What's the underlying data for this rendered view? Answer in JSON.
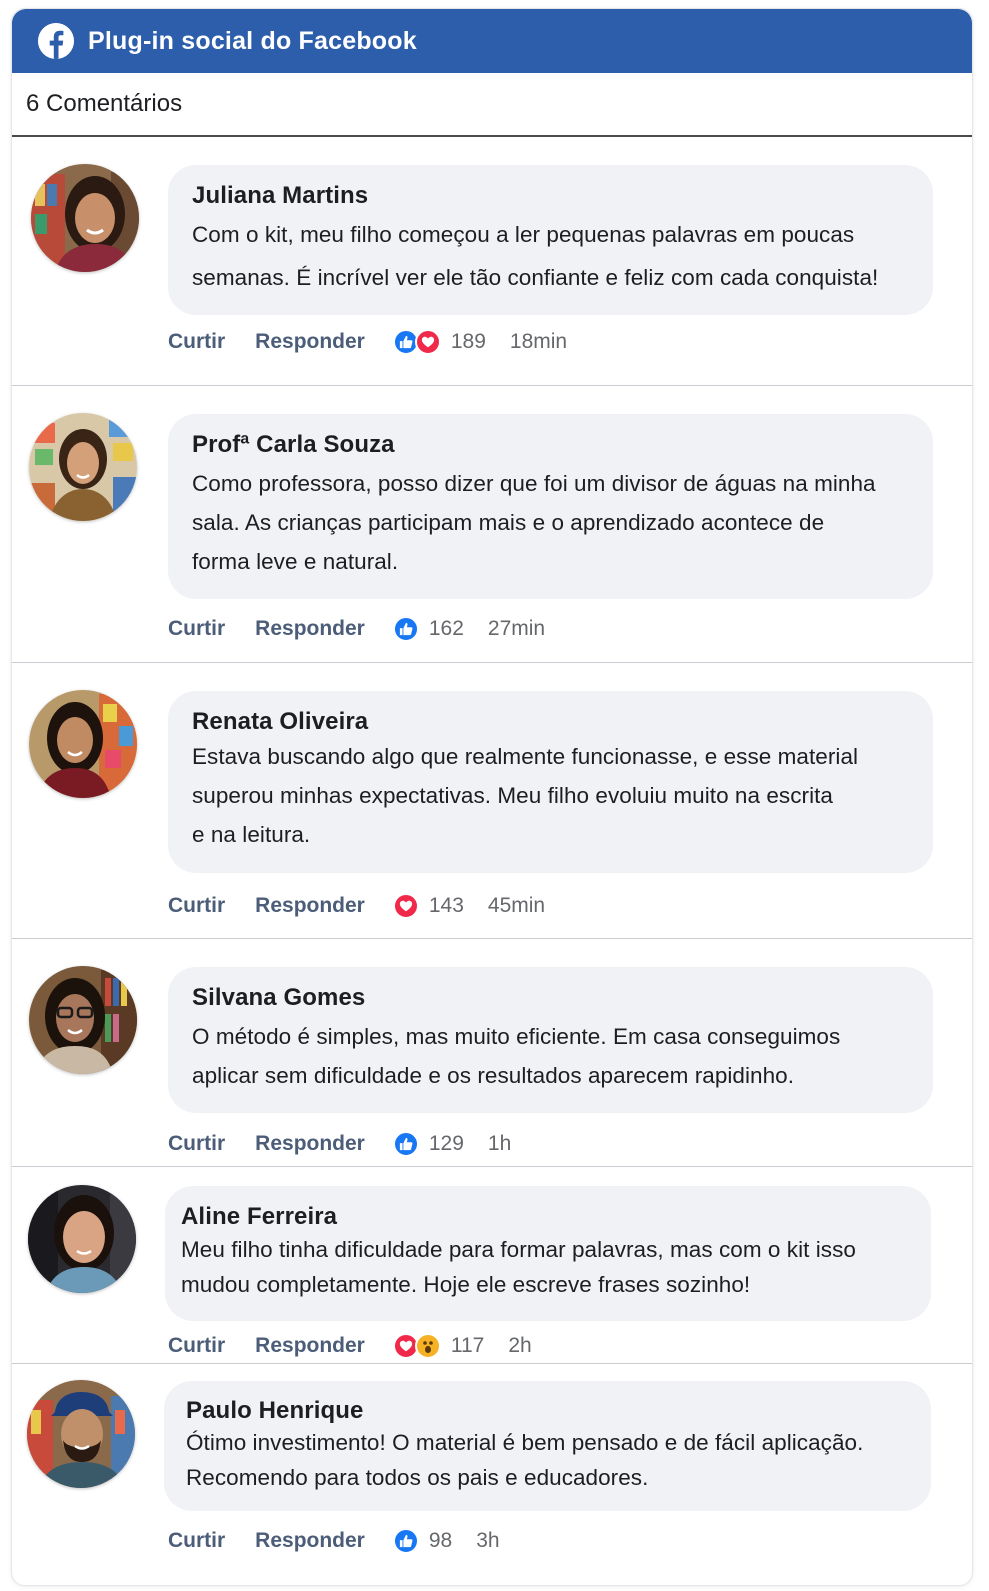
{
  "header": {
    "title": "Plug-in social do Facebook",
    "icon": "facebook-logo-icon",
    "color": "#2d5eab"
  },
  "comments_count": "6 Comentários",
  "actions": {
    "like_label": "Curtir",
    "reply_label": "Responder"
  },
  "comments": [
    {
      "author": "Juliana Martins",
      "lines": [
        "Com o kit, meu filho começou a ler pequenas palavras em poucas",
        "semanas. É incrível ver ele tão confiante e feliz com cada conquista!"
      ],
      "reactions": [
        "like",
        "love"
      ],
      "reaction_count": "189",
      "time": "18min"
    },
    {
      "author": "Profª Carla Souza",
      "lines": [
        "Como professora, posso dizer que foi um divisor de águas na minha",
        "sala. As crianças participam mais e o aprendizado acontece de",
        "forma leve e natural."
      ],
      "reactions": [
        "like"
      ],
      "reaction_count": "162",
      "time": "27min"
    },
    {
      "author": "Renata Oliveira",
      "lines": [
        "Estava buscando algo que realmente funcionasse, e esse material",
        "superou minhas expectativas. Meu filho evoluiu muito na escrita",
        "e na leitura."
      ],
      "reactions": [
        "love"
      ],
      "reaction_count": "143",
      "time": "45min"
    },
    {
      "author": "Silvana Gomes",
      "lines": [
        "O método é simples, mas muito eficiente. Em casa conseguimos",
        "aplicar sem dificuldade e os resultados aparecem rapidinho."
      ],
      "reactions": [
        "like"
      ],
      "reaction_count": "129",
      "time": "1h"
    },
    {
      "author": "Aline Ferreira",
      "lines": [
        "Meu filho tinha dificuldade para formar palavras, mas com o kit isso",
        "mudou completamente. Hoje ele escreve frases sozinho!"
      ],
      "reactions": [
        "love",
        "wow"
      ],
      "reaction_count": "117",
      "time": "2h"
    },
    {
      "author": "Paulo Henrique",
      "lines": [
        "Ótimo investimento! O material é bem pensado e de fácil aplicação.",
        "Recomendo para todos os pais e educadores."
      ],
      "reactions": [
        "like"
      ],
      "reaction_count": "98",
      "time": "3h"
    }
  ],
  "colors": {
    "like": "#1877f2",
    "love": "#f02849",
    "wow": "#f7b125",
    "bubble": "#f0f2f5",
    "action_text": "#4b5d78"
  }
}
